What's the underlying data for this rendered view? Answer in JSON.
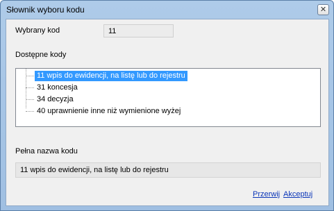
{
  "window": {
    "title": "Słownik wyboru kodu"
  },
  "selected_code": {
    "label": "Wybrany kod",
    "value": "11"
  },
  "available": {
    "label": "Dostępne kody",
    "items": [
      {
        "text": "11   wpis do ewidencji, na listę lub do rejestru",
        "selected": true
      },
      {
        "text": "31   koncesja",
        "selected": false
      },
      {
        "text": "34   decyzja",
        "selected": false
      },
      {
        "text": "40   uprawnienie inne niż wymienione wyżej",
        "selected": false
      }
    ]
  },
  "full_name": {
    "label": "Pełna nazwa kodu",
    "value": "11   wpis do ewidencji, na listę lub do rejestru"
  },
  "buttons": {
    "cancel": "Przerwij",
    "accept": "Akceptuj"
  },
  "colors": {
    "selection": "#3399ff",
    "link": "#0a35b8"
  }
}
